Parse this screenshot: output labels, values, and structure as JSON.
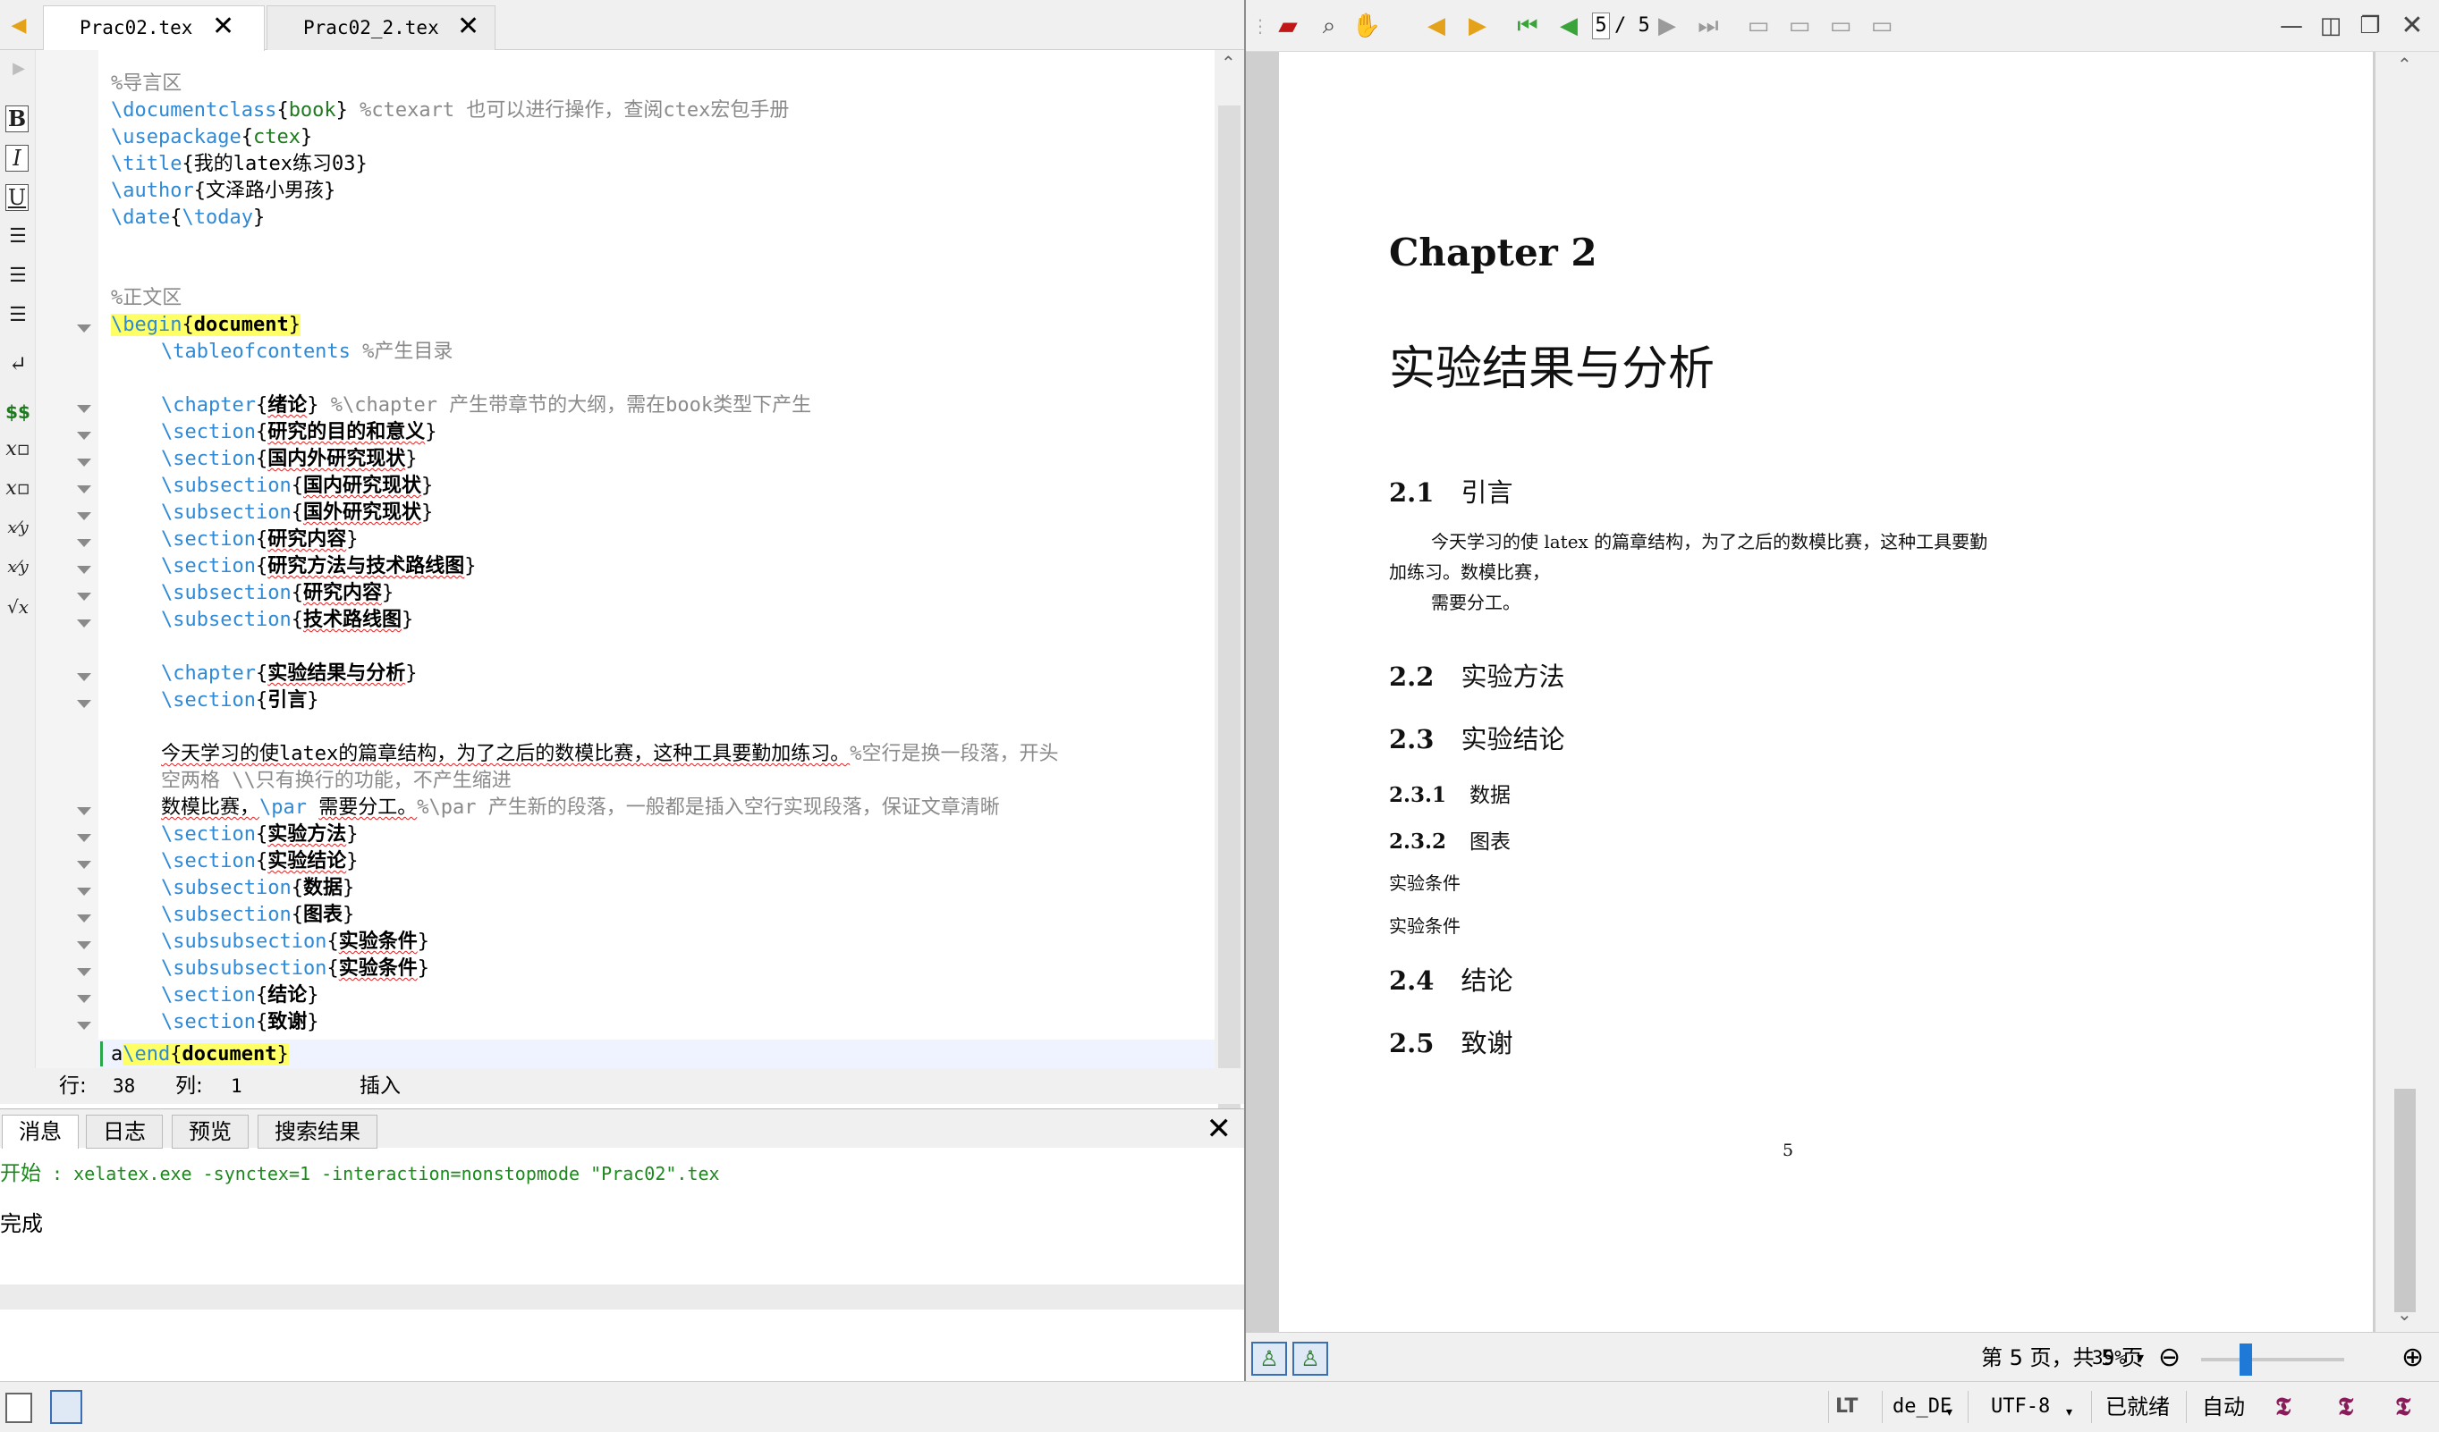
{
  "editor": {
    "tabs": [
      {
        "label": "Prac02.tex",
        "active": true
      },
      {
        "label": "Prac02_2.tex",
        "active": false
      }
    ],
    "format_tools": [
      "bold",
      "italic",
      "underline",
      "align-left",
      "align-center",
      "align-right",
      "newline",
      "math",
      "subscript",
      "superscript",
      "fraction",
      "dfrac",
      "sqrt"
    ],
    "format_labels": {
      "bold": "B",
      "italic": "I",
      "underline": "U",
      "math": "$$",
      "sqrt": "√x"
    },
    "code": {
      "l1": "%导言区",
      "l2_cmd": "\\documentclass",
      "l2_arg": "book",
      "l2_comment": "%ctexart 也可以进行操作，查阅ctex宏包手册",
      "l3_cmd": "\\usepackage",
      "l3_arg": "ctex",
      "l4_cmd": "\\title",
      "l4_arg": "我的latex练习03",
      "l5_cmd": "\\author",
      "l5_arg": "文泽路小男孩",
      "l6_cmd": "\\date",
      "l6_arg": "\\today",
      "l9": "%正文区",
      "l10_cmd": "\\begin",
      "l10_arg": "document",
      "l11_cmd": "\\tableofcontents",
      "l11_comment": "%产生目录",
      "l13_cmd": "\\chapter",
      "l13_arg": "绪论",
      "l13_comment": "%\\chapter 产生带章节的大纲，需在book类型下产生",
      "l14_cmd": "\\section",
      "l14_arg": "研究的目的和意义",
      "l15_cmd": "\\section",
      "l15_arg": "国内外研究现状",
      "l16_cmd": "\\subsection",
      "l16_arg": "国内研究现状",
      "l17_cmd": "\\subsection",
      "l17_arg": "国外研究现状",
      "l18_cmd": "\\section",
      "l18_arg": "研究内容",
      "l19_cmd": "\\section",
      "l19_arg": "研究方法与技术路线图",
      "l20_cmd": "\\subsection",
      "l20_arg": "研究内容",
      "l21_cmd": "\\subsection",
      "l21_arg": "技术路线图",
      "l23_cmd": "\\chapter",
      "l23_arg": "实验结果与分析",
      "l24_cmd": "\\section",
      "l24_arg": "引言",
      "l26_text": "今天学习的使latex的篇章结构，为了之后的数模比赛，这种工具要勤加练习。",
      "l26_comment": "%空行是换一段落，开头",
      "l26b_comment": "空两格 \\\\只有换行的功能，不产生缩进",
      "l27_text": "数模比赛，",
      "l27_cmd": "\\par",
      "l27_text2": "需要分工。",
      "l27_comment": "%\\par 产生新的段落，一般都是插入空行实现段落，保证文章清晰",
      "l28_cmd": "\\section",
      "l28_arg": "实验方法",
      "l29_cmd": "\\section",
      "l29_arg": "实验结论",
      "l30_cmd": "\\subsection",
      "l30_arg": "数据",
      "l31_cmd": "\\subsection",
      "l31_arg": "图表",
      "l32_cmd": "\\subsubsection",
      "l32_arg": "实验条件",
      "l33_cmd": "\\subsubsection",
      "l33_arg": "实验条件",
      "l34_cmd": "\\section",
      "l34_arg": "结论",
      "l35_cmd": "\\section",
      "l35_arg": "致谢",
      "l36_pre": "a",
      "l36_cmd": "\\end",
      "l36_arg": "document"
    },
    "status": {
      "line_label": "行:",
      "line": "38",
      "col_label": "列:",
      "col": "1",
      "mode": "插入"
    }
  },
  "messages": {
    "tabs": [
      "消息",
      "日志",
      "预览",
      "搜索结果"
    ],
    "start_label": "开始",
    "command": " : xelatex.exe -synctex=1 -interaction=nonstopmode \"Prac02\".tex",
    "done": "完成"
  },
  "pdf_viewer": {
    "current_page": "5",
    "total_pages": "/ 5",
    "page": {
      "chapter_label": "Chapter 2",
      "chapter_title": "实验结果与分析",
      "sections": [
        {
          "num": "2.1",
          "title": "引言"
        },
        {
          "num": "2.2",
          "title": "实验方法"
        },
        {
          "num": "2.3",
          "title": "实验结论"
        },
        {
          "num": "2.4",
          "title": "结论"
        },
        {
          "num": "2.5",
          "title": "致谢"
        }
      ],
      "subsections": [
        {
          "num": "2.3.1",
          "title": "数据"
        },
        {
          "num": "2.3.2",
          "title": "图表"
        }
      ],
      "subsubsections": [
        "实验条件",
        "实验条件"
      ],
      "para1_line1": "今天学习的使 latex 的篇章结构，为了之后的数模比赛，这种工具要勤",
      "para1_line2": "加练习。数模比赛，",
      "para2": "需要分工。",
      "page_number": "5"
    },
    "status": {
      "page_text": "第 5 页，共 5 页",
      "zoom": "39%",
      "zoom_level_percent": 39
    }
  },
  "bottom_bar": {
    "language": "de_DE",
    "encoding": "UTF-8",
    "state": "已就绪",
    "mode": "自动"
  },
  "colors": {
    "keyword": "#2e8ad7",
    "comment": "#8a8a8a",
    "start_green": "#1a8a1a",
    "highlight": "#ffff66"
  }
}
